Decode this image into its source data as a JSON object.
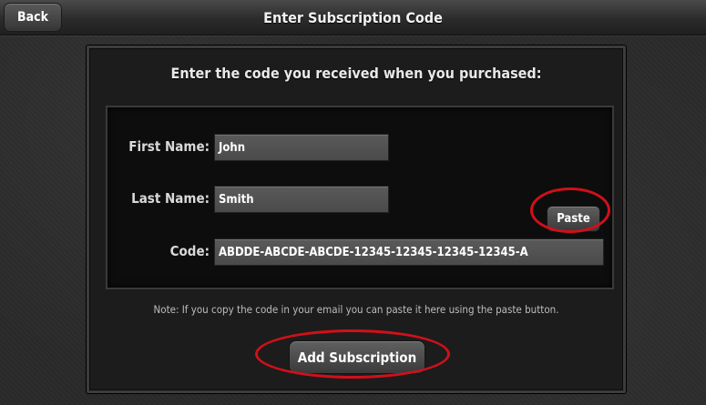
{
  "header": {
    "back_label": "Back",
    "title": "Enter Subscription Code"
  },
  "form": {
    "heading": "Enter the code you received when you purchased:",
    "first_name": {
      "label": "First Name:",
      "value": "John"
    },
    "last_name": {
      "label": "Last Name:",
      "value": "Smith"
    },
    "code": {
      "label": "Code:",
      "value": "ABDDE-ABCDE-ABCDE-12345-12345-12345-12345-A"
    },
    "paste_label": "Paste",
    "note": "Note: If you copy the code in your email you can paste it here using the paste button.",
    "submit_label": "Add Subscription"
  },
  "annotation_color": "#d0101a"
}
